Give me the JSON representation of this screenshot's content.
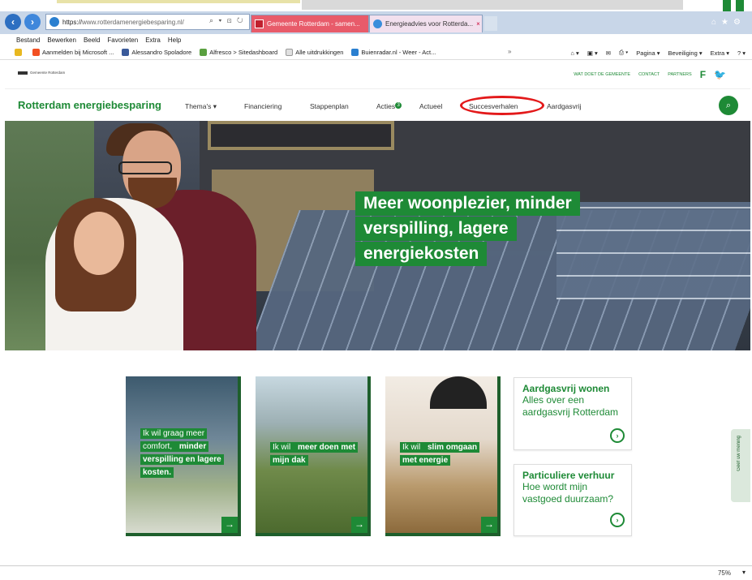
{
  "browser": {
    "url_proto": "https://",
    "url_rest": "www.rotterdamenergiebesparing.nl/",
    "tabs": [
      {
        "label": "Gemeente Rotterdam - samen..."
      },
      {
        "label": "Energieadvies voor Rotterda...",
        "close": "×"
      }
    ],
    "menu": [
      "Bestand",
      "Bewerken",
      "Beeld",
      "Favorieten",
      "Extra",
      "Help"
    ],
    "favorites": [
      "Aanmelden bij Microsoft ...",
      "Alessandro Spoladore",
      "Alfresco > Sitedashboard",
      "Alle uitdrukkingen",
      "Buienradar.nl - Weer - Act..."
    ],
    "toolbar_right": [
      "Pagina ▾",
      "Beveiliging ▾",
      "Extra ▾"
    ],
    "zoom": "75%"
  },
  "site": {
    "municipality": "Gemeente Rotterdam",
    "util_links": [
      "WAT DOET DE GEMEENTE",
      "CONTACT",
      "PARTNERS"
    ],
    "social": [
      "f",
      "t"
    ],
    "brand": "Rotterdam energiebesparing",
    "nav": [
      "Thema's ▾",
      "Financiering",
      "Stappenplan",
      "Acties",
      "Actueel",
      "Succesverhalen",
      "Aardgasvrij"
    ],
    "acties_badge": "3",
    "headline": [
      "Meer woonplezier, minder",
      "verspilling, lagere",
      "energiekosten"
    ],
    "tiles": [
      {
        "text_a": "Ik wil graag meer comfort, ",
        "text_b": "minder verspilling en lagere kosten.",
        "arrow": "→"
      },
      {
        "text_a": "Ik wil ",
        "text_b": "meer doen met mijn dak",
        "arrow": "→"
      },
      {
        "text_a": "Ik wil ",
        "text_b": "slim omgaan met energie",
        "arrow": "→"
      }
    ],
    "cards": [
      {
        "title": "Aardgasvrij wonen",
        "body": "Alles over een aardgasvrij Rotterdam",
        "btn": "›"
      },
      {
        "title": "Particuliere verhuur",
        "body": "Hoe wordt mijn vastgoed duurzaam?",
        "btn": "›"
      }
    ],
    "feedback": "Geef uw mening"
  },
  "colors": {
    "brand_green": "#1e8a36",
    "highlight_red": "#e3191a"
  }
}
